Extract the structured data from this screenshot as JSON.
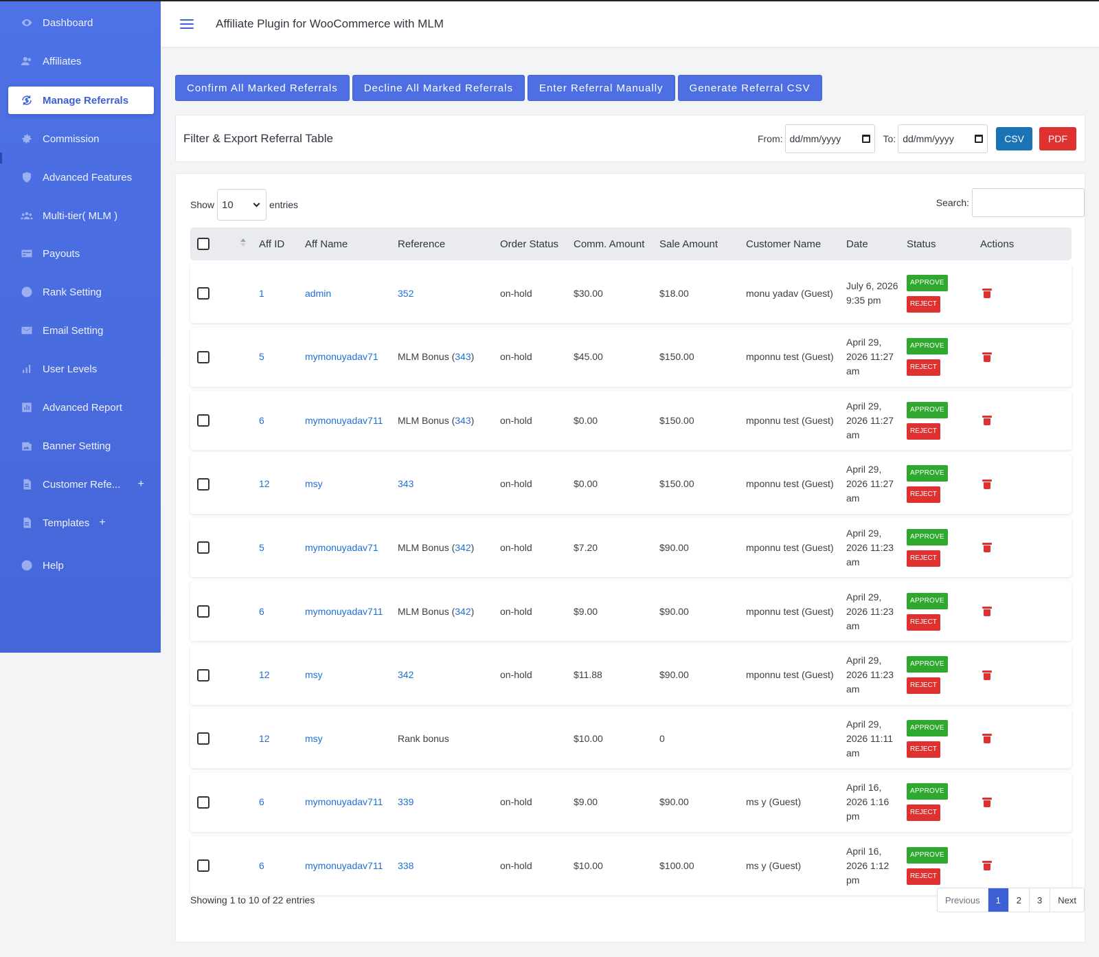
{
  "app": {
    "title": "Affiliate Plugin for WooCommerce with MLM"
  },
  "sidebar": {
    "items": [
      {
        "label": "Dashboard",
        "icon": "eye-icon"
      },
      {
        "label": "Affiliates",
        "icon": "users-icon"
      },
      {
        "label": "Manage Referrals",
        "icon": "refresh-dollar-icon",
        "active": true
      },
      {
        "label": "Commission",
        "icon": "gear-icon"
      },
      {
        "label": "Advanced Features",
        "icon": "shield-icon"
      },
      {
        "label": "Multi-tier( MLM )",
        "icon": "group-icon"
      },
      {
        "label": "Payouts",
        "icon": "card-icon"
      },
      {
        "label": "Rank Setting",
        "icon": "star-icon"
      },
      {
        "label": "Email Setting",
        "icon": "mail-icon"
      },
      {
        "label": "User Levels",
        "icon": "bar-chart-icon"
      },
      {
        "label": "Advanced Report",
        "icon": "report-icon"
      },
      {
        "label": "Banner Setting",
        "icon": "image-icon"
      },
      {
        "label": "Customer Refe...",
        "icon": "doc-icon",
        "expand": "+"
      },
      {
        "label": "Templates",
        "icon": "doc-icon",
        "expand": "+"
      },
      {
        "label": "Help",
        "icon": "help-icon"
      }
    ]
  },
  "toolbar": {
    "confirm": "Confirm All Marked Referrals",
    "decline": "Decline All Marked Referrals",
    "manual": "Enter Referral Manually",
    "csv": "Generate Referral CSV"
  },
  "filter": {
    "title": "Filter & Export Referral Table",
    "from_label": "From:",
    "to_label": "To:",
    "from_value": "dd/mm/yyyy",
    "to_value": "dd/mm/yyyy",
    "csv": "CSV",
    "pdf": "PDF"
  },
  "table": {
    "show_label": "Show",
    "entries_label": "entries",
    "page_length": "10",
    "search_label": "Search:",
    "columns": [
      "Aff ID",
      "Aff Name",
      "Reference",
      "Order Status",
      "Comm. Amount",
      "Sale Amount",
      "Customer Name",
      "Date",
      "Status",
      "Actions"
    ],
    "approve": "APPROVE",
    "reject": "REJECT",
    "rows": [
      {
        "aff_id": "1",
        "aff_name": "admin",
        "ref_prefix": "",
        "ref_link": "352",
        "ref_suffix": "",
        "order_status": "on-hold",
        "comm": "$30.00",
        "sale": "$18.00",
        "customer": "monu yadav (Guest)",
        "date": "July 6, 2026 9:35 pm"
      },
      {
        "aff_id": "5",
        "aff_name": "mymonuyadav71",
        "ref_prefix": "MLM Bonus (",
        "ref_link": "343",
        "ref_suffix": " )",
        "order_status": "on-hold",
        "comm": "$45.00",
        "sale": "$150.00",
        "customer": "mponnu test (Guest)",
        "date": "April 29, 2026 11:27 am"
      },
      {
        "aff_id": "6",
        "aff_name": "mymonuyadav711",
        "ref_prefix": "MLM Bonus (",
        "ref_link": "343",
        "ref_suffix": " )",
        "order_status": "on-hold",
        "comm": "$0.00",
        "sale": "$150.00",
        "customer": "mponnu test (Guest)",
        "date": "April 29, 2026 11:27 am"
      },
      {
        "aff_id": "12",
        "aff_name": "msy",
        "ref_prefix": "",
        "ref_link": "343",
        "ref_suffix": "",
        "order_status": "on-hold",
        "comm": "$0.00",
        "sale": "$150.00",
        "customer": "mponnu test (Guest)",
        "date": "April 29, 2026 11:27 am"
      },
      {
        "aff_id": "5",
        "aff_name": "mymonuyadav71",
        "ref_prefix": "MLM Bonus (",
        "ref_link": "342",
        "ref_suffix": " )",
        "order_status": "on-hold",
        "comm": "$7.20",
        "sale": "$90.00",
        "customer": "mponnu test (Guest)",
        "date": "April 29, 2026 11:23 am"
      },
      {
        "aff_id": "6",
        "aff_name": "mymonuyadav711",
        "ref_prefix": "MLM Bonus (",
        "ref_link": "342",
        "ref_suffix": " )",
        "order_status": "on-hold",
        "comm": "$9.00",
        "sale": "$90.00",
        "customer": "mponnu test (Guest)",
        "date": "April 29, 2026 11:23 am"
      },
      {
        "aff_id": "12",
        "aff_name": "msy",
        "ref_prefix": "",
        "ref_link": "342",
        "ref_suffix": "",
        "order_status": "on-hold",
        "comm": "$11.88",
        "sale": "$90.00",
        "customer": "mponnu test (Guest)",
        "date": "April 29, 2026 11:23 am"
      },
      {
        "aff_id": "12",
        "aff_name": "msy",
        "ref_prefix": "Rank bonus",
        "ref_link": "",
        "ref_suffix": "",
        "order_status": "",
        "comm": "$10.00",
        "sale": "0",
        "customer": "",
        "date": "April 29, 2026 11:11 am"
      },
      {
        "aff_id": "6",
        "aff_name": "mymonuyadav711",
        "ref_prefix": "",
        "ref_link": "339",
        "ref_suffix": "",
        "order_status": "on-hold",
        "comm": "$9.00",
        "sale": "$90.00",
        "customer": "ms y (Guest)",
        "date": "April 16, 2026 1:16 pm"
      },
      {
        "aff_id": "6",
        "aff_name": "mymonuyadav711",
        "ref_prefix": "",
        "ref_link": "338",
        "ref_suffix": "",
        "order_status": "on-hold",
        "comm": "$10.00",
        "sale": "$100.00",
        "customer": "ms y (Guest)",
        "date": "April 16, 2026 1:12 pm"
      }
    ],
    "info": "Showing 1 to 10 of 22 entries",
    "pagination": {
      "previous": "Previous",
      "pages": [
        "1",
        "2",
        "3"
      ],
      "current": "1",
      "next": "Next"
    }
  },
  "colors": {
    "sidebar": "#4c6fe0",
    "primary": "#4e6fe3",
    "link": "#1f6fd6",
    "approve": "#2ea82e",
    "reject": "#e03131",
    "csv": "#1a73b5"
  }
}
